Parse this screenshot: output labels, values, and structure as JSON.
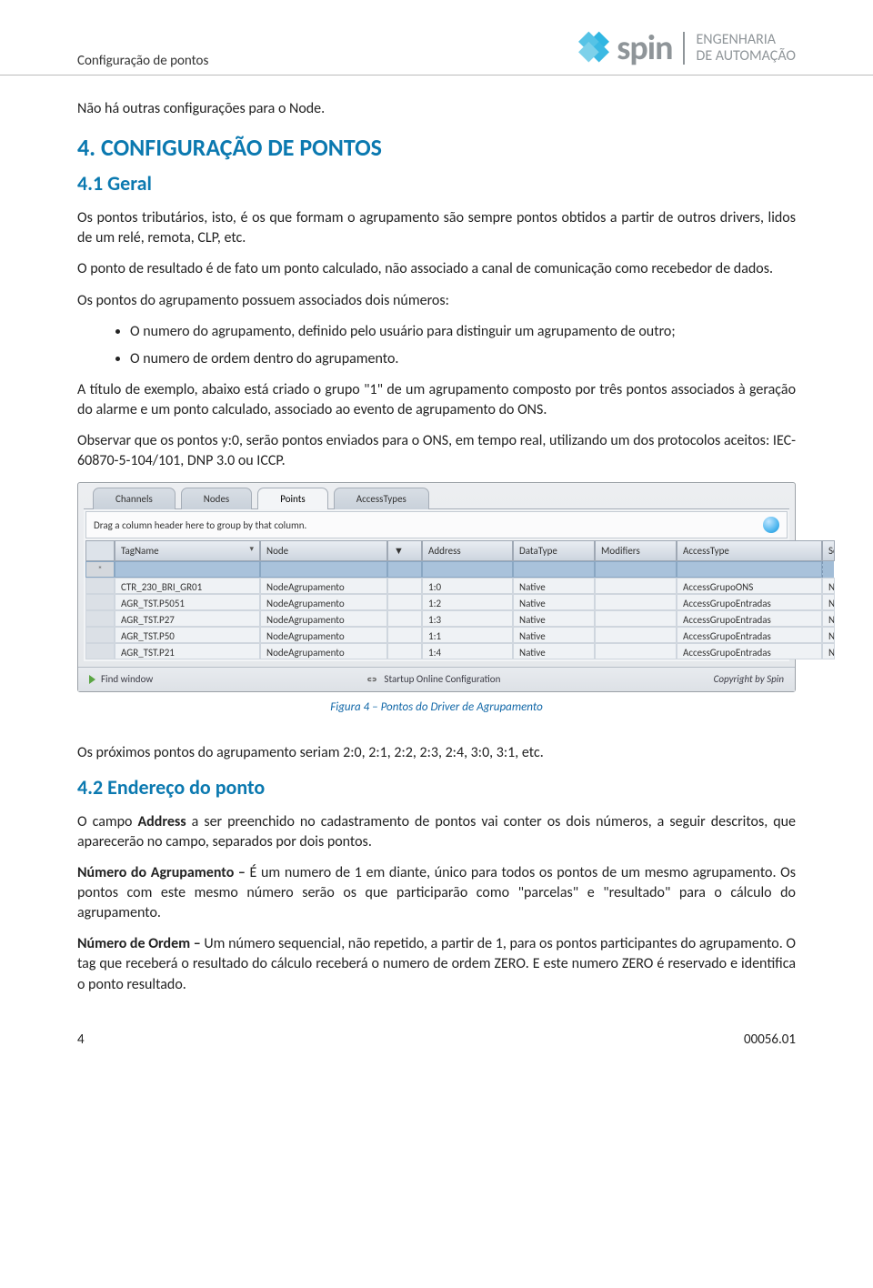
{
  "header": {
    "breadcrumb": "Configuração de pontos",
    "logo_main": "spin",
    "logo_sub1": "ENGENHARIA",
    "logo_sub2": "DE AUTOMAÇÃO"
  },
  "p_intro": "Não há outras configurações para o Node.",
  "h2": "4. CONFIGURAÇÃO DE PONTOS",
  "h3_1": "4.1 Geral",
  "p1": "Os pontos tributários, isto, é os que formam o agrupamento são sempre pontos obtidos a partir de outros drivers, lidos de um relé, remota, CLP, etc.",
  "p2": "O ponto de resultado é de fato um ponto calculado, não associado a canal de comunicação como recebedor de dados.",
  "p3": "Os pontos do agrupamento possuem associados dois números:",
  "li1": "O numero do agrupamento, definido pelo usuário para distinguir um agrupamento de outro;",
  "li2": "O numero de ordem dentro do agrupamento.",
  "p4": "A título de exemplo, abaixo está criado o grupo \"1\" de um agrupamento composto por três pontos associados à geração do alarme e um ponto calculado, associado ao evento de agrupamento do ONS.",
  "p5": "Observar que os pontos y:0, serão pontos enviados para o ONS, em tempo real, utilizando um dos protocolos aceitos: IEC-60870-5-104/101, DNP 3.0 ou ICCP.",
  "panel": {
    "tabs": [
      "Channels",
      "Nodes",
      "Points",
      "AccessTypes"
    ],
    "group_hint": "Drag a column header here to group by that column.",
    "columns": [
      "",
      "TagName",
      "Node",
      "",
      "Address",
      "DataType",
      "Modifiers",
      "AccessType",
      "Scaling"
    ],
    "filter_placeholder_star": "*",
    "rows": [
      {
        "tag": "CTR_230_BRI_GR01",
        "node": "NodeAgrupamento",
        "addr": "1:0",
        "dt": "Native",
        "mod": "",
        "at": "AccessGrupoONS",
        "sc": "None"
      },
      {
        "tag": "AGR_TST.P5051",
        "node": "NodeAgrupamento",
        "addr": "1:2",
        "dt": "Native",
        "mod": "",
        "at": "AccessGrupoEntradas",
        "sc": "None"
      },
      {
        "tag": "AGR_TST.P27",
        "node": "NodeAgrupamento",
        "addr": "1:3",
        "dt": "Native",
        "mod": "",
        "at": "AccessGrupoEntradas",
        "sc": "None"
      },
      {
        "tag": "AGR_TST.P50",
        "node": "NodeAgrupamento",
        "addr": "1:1",
        "dt": "Native",
        "mod": "",
        "at": "AccessGrupoEntradas",
        "sc": "None"
      },
      {
        "tag": "AGR_TST.P21",
        "node": "NodeAgrupamento",
        "addr": "1:4",
        "dt": "Native",
        "mod": "",
        "at": "AccessGrupoEntradas",
        "sc": "None"
      }
    ],
    "status_left": "Find window",
    "status_center": "Startup Online Configuration",
    "status_right": "Copyright by Spin"
  },
  "fig_caption": "Figura 4 – Pontos do Driver de Agrupamento",
  "p6": "Os próximos pontos do agrupamento seriam 2:0, 2:1, 2:2, 2:3, 2:4, 3:0, 3:1, etc.",
  "h3_2": "4.2 Endereço do ponto",
  "p7a": "O campo ",
  "p7b": "Address",
  "p7c": " a ser preenchido no cadastramento de pontos vai conter os dois números, a seguir descritos, que aparecerão no campo, separados por dois pontos.",
  "p8a": "Número do Agrupamento –",
  "p8b": " É um numero de 1 em diante, único para todos os pontos de um mesmo agrupamento. Os pontos com este mesmo número serão os que participarão como \"parcelas\" e \"resultado\" para o cálculo do agrupamento.",
  "p9a": "Número de Ordem –",
  "p9b": " Um número sequencial, não repetido, a partir de 1, para os pontos participantes do agrupamento. O tag que receberá o resultado do cálculo receberá o numero de ordem ZERO.  E este numero ZERO é reservado e identifica o ponto resultado.",
  "footer": {
    "page": "4",
    "doc": "00056.01"
  },
  "chart_data": {
    "type": "table",
    "columns": [
      "TagName",
      "Node",
      "Address",
      "DataType",
      "Modifiers",
      "AccessType",
      "Scaling"
    ],
    "rows": [
      [
        "CTR_230_BRI_GR01",
        "NodeAgrupamento",
        "1:0",
        "Native",
        "",
        "AccessGrupoONS",
        "None"
      ],
      [
        "AGR_TST.P5051",
        "NodeAgrupamento",
        "1:2",
        "Native",
        "",
        "AccessGrupoEntradas",
        "None"
      ],
      [
        "AGR_TST.P27",
        "NodeAgrupamento",
        "1:3",
        "Native",
        "",
        "AccessGrupoEntradas",
        "None"
      ],
      [
        "AGR_TST.P50",
        "NodeAgrupamento",
        "1:1",
        "Native",
        "",
        "AccessGrupoEntradas",
        "None"
      ],
      [
        "AGR_TST.P21",
        "NodeAgrupamento",
        "1:4",
        "Native",
        "",
        "AccessGrupoEntradas",
        "None"
      ]
    ]
  }
}
